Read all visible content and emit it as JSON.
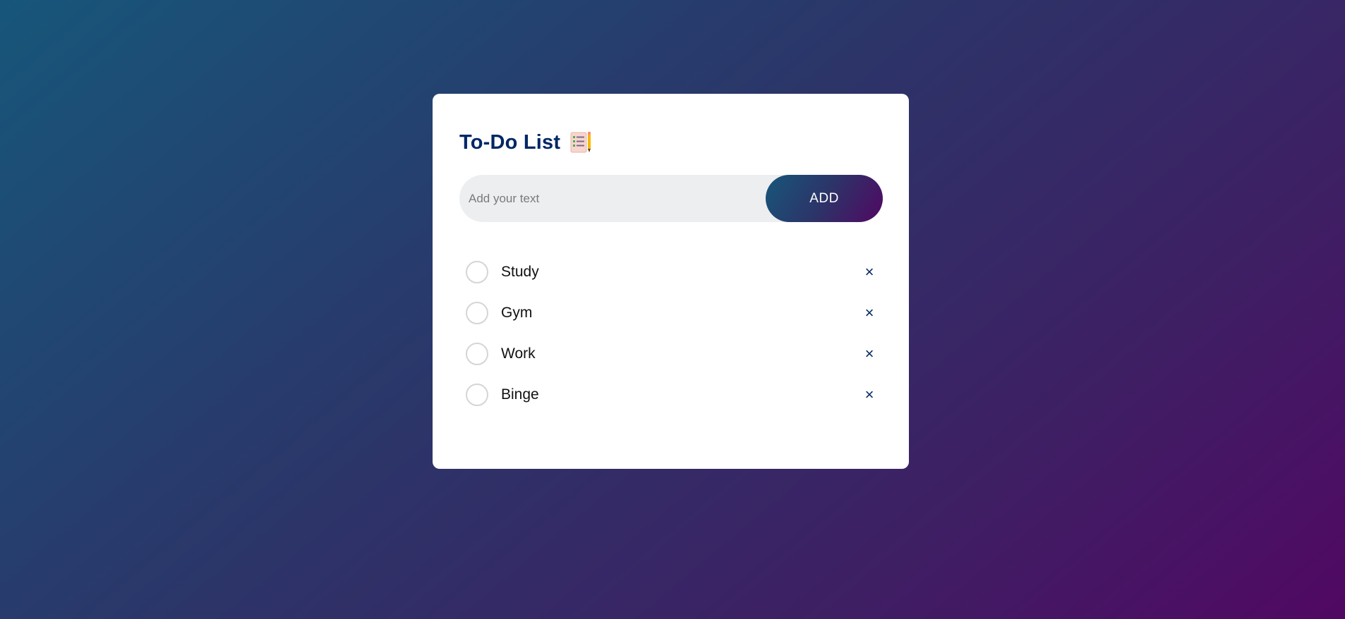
{
  "app": {
    "title": "To-Do List",
    "title_icon": "checklist-pencil-emoji"
  },
  "input": {
    "value": "",
    "placeholder": "Add your text"
  },
  "add_button": {
    "label": "ADD"
  },
  "todos": [
    {
      "label": "Study",
      "done": false
    },
    {
      "label": "Gym",
      "done": false
    },
    {
      "label": "Work",
      "done": false
    },
    {
      "label": "Binge",
      "done": false
    }
  ],
  "remove_symbol": "×",
  "colors": {
    "title": "#002765",
    "gradient_start": "#17567a",
    "gradient_end": "#510863",
    "input_bg": "#edeef0"
  }
}
